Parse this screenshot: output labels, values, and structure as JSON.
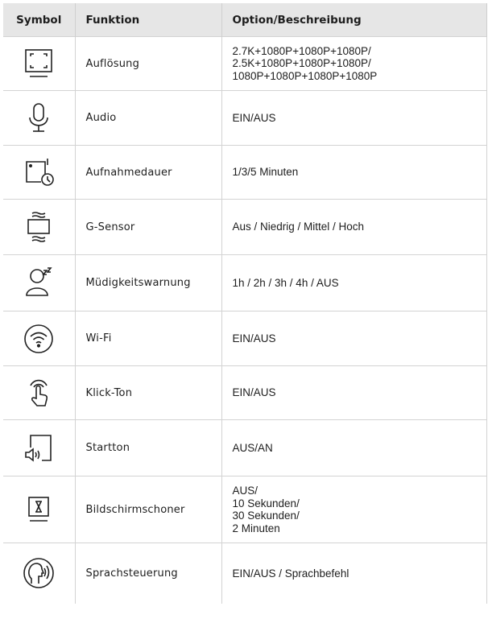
{
  "header": {
    "symbol": "Symbol",
    "function": "Funktion",
    "option": "Option/Beschreibung"
  },
  "rows": [
    {
      "icon": "resolution-frame-icon",
      "function": "Auflösung",
      "option": "2.7K+1080P+1080P+1080P/\n2.5K+1080P+1080P+1080P/\n1080P+1080P+1080P+1080P"
    },
    {
      "icon": "microphone-icon",
      "function": "Audio",
      "option": "EIN/AUS"
    },
    {
      "icon": "recording-duration-icon",
      "function": "Aufnahmedauer",
      "option": "1/3/5 Minuten"
    },
    {
      "icon": "g-sensor-icon",
      "function": "G-Sensor",
      "option": "Aus / Niedrig / Mittel / Hoch"
    },
    {
      "icon": "fatigue-warning-icon",
      "function": "Müdigkeitswarnung",
      "option": "1h / 2h / 3h / 4h / AUS"
    },
    {
      "icon": "wifi-icon",
      "function": "Wi-Fi",
      "option": "EIN/AUS"
    },
    {
      "icon": "click-tone-icon",
      "function": "Klick-Ton",
      "option": "EIN/AUS"
    },
    {
      "icon": "startup-tone-icon",
      "function": "Startton",
      "option": "AUS/AN"
    },
    {
      "icon": "screensaver-hourglass-icon",
      "function": "Bildschirmschoner",
      "option": "AUS/\n10 Sekunden/\n30 Sekunden/\n2 Minuten"
    },
    {
      "icon": "voice-control-icon",
      "function": "Sprachsteuerung",
      "option": "EIN/AUS / Sprachbefehl"
    }
  ]
}
